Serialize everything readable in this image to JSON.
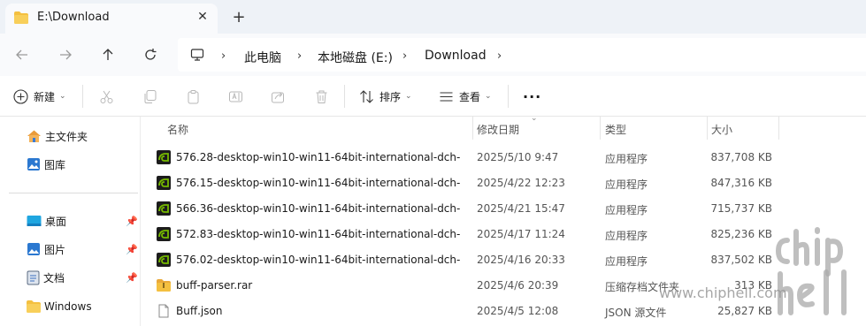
{
  "window": {
    "tab_title": "E:\\Download",
    "tab_close_glyph": "✕",
    "new_tab_glyph": "+"
  },
  "breadcrumb": {
    "items": [
      "此电脑",
      "本地磁盘 (E:)",
      "Download"
    ],
    "separator": "›"
  },
  "toolbar": {
    "new_label": "新建",
    "sort_label": "排序",
    "view_label": "查看",
    "more_glyph": "···"
  },
  "sidebar": {
    "top_items": [
      {
        "label": "主文件夹",
        "icon": "home-icon"
      },
      {
        "label": "图库",
        "icon": "gallery-icon"
      }
    ],
    "pinned_items": [
      {
        "label": "桌面",
        "icon": "desktop-icon",
        "pinned": true
      },
      {
        "label": "图片",
        "icon": "pictures-icon",
        "pinned": true
      },
      {
        "label": "文档",
        "icon": "documents-icon",
        "pinned": true
      },
      {
        "label": "Windows",
        "icon": "folder-icon",
        "pinned": false
      }
    ]
  },
  "columns": {
    "name": "名称",
    "date": "修改日期",
    "type": "类型",
    "size": "大小"
  },
  "files": [
    {
      "name": "576.28-desktop-win10-win11-64bit-international-dch-...",
      "date": "2025/5/10 9:47",
      "type": "应用程序",
      "size": "837,708 KB",
      "icon": "nvidia-app-icon"
    },
    {
      "name": "576.15-desktop-win10-win11-64bit-international-dch-...",
      "date": "2025/4/22 12:23",
      "type": "应用程序",
      "size": "847,316 KB",
      "icon": "nvidia-app-icon"
    },
    {
      "name": "566.36-desktop-win10-win11-64bit-international-dch-...",
      "date": "2025/4/21 15:47",
      "type": "应用程序",
      "size": "715,737 KB",
      "icon": "nvidia-app-icon"
    },
    {
      "name": "572.83-desktop-win10-win11-64bit-international-dch-...",
      "date": "2025/4/17 11:24",
      "type": "应用程序",
      "size": "825,236 KB",
      "icon": "nvidia-app-icon"
    },
    {
      "name": "576.02-desktop-win10-win11-64bit-international-dch-...",
      "date": "2025/4/16 20:33",
      "type": "应用程序",
      "size": "837,502 KB",
      "icon": "nvidia-app-icon"
    },
    {
      "name": "buff-parser.rar",
      "date": "2025/4/6 20:39",
      "type": "压缩存档文件夹",
      "size": "313 KB",
      "icon": "archive-icon"
    },
    {
      "name": "Buff.json",
      "date": "2025/4/5 12:08",
      "type": "JSON 源文件",
      "size": "25,827 KB",
      "icon": "json-file-icon"
    }
  ],
  "watermark": {
    "url": "www.chiphell.com"
  },
  "colors": {
    "tabbar_bg": "#eef2f7",
    "folder_yellow": "#f4c040",
    "nvidia_green": "#76b900",
    "accent_blue": "#2b78d0"
  }
}
